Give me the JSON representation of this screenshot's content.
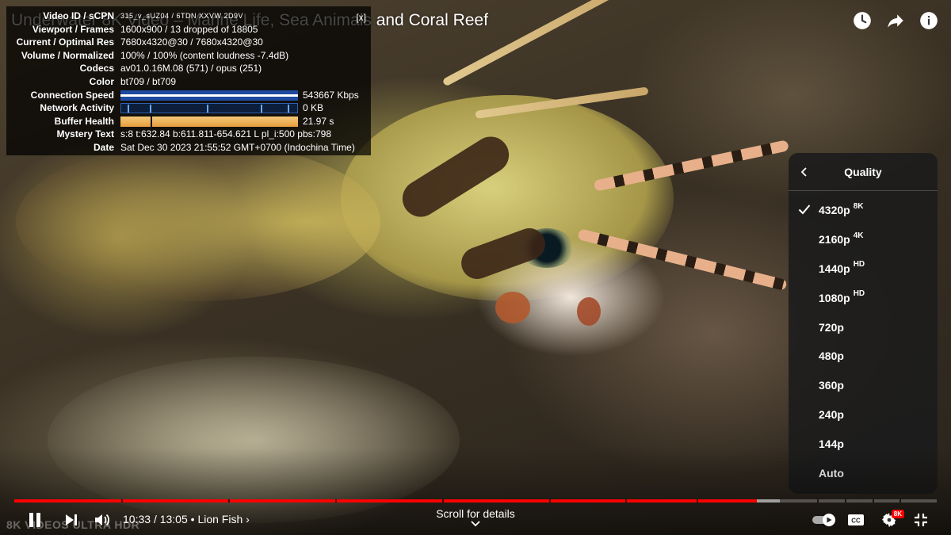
{
  "video": {
    "title": "Underwater 8K Video – Marine Life, Sea Animals and Coral Reef",
    "watermark": "8K VIDEOS ULTRA HDR"
  },
  "stats": {
    "close_label": "[x]",
    "video_id": {
      "label": "Video ID / sCPN",
      "value": "315_v_sUZ04 / 6TDN XXVW 2D9V"
    },
    "viewport": {
      "label": "Viewport / Frames",
      "value": "1600x900 / 13 dropped of 18805"
    },
    "resolution": {
      "label": "Current / Optimal Res",
      "value": "7680x4320@30 / 7680x4320@30"
    },
    "volume": {
      "label": "Volume / Normalized",
      "value": "100% / 100% (content loudness -7.4dB)"
    },
    "codecs": {
      "label": "Codecs",
      "value": "av01.0.16M.08 (571) / opus (251)"
    },
    "color": {
      "label": "Color",
      "value": "bt709 / bt709"
    },
    "connection": {
      "label": "Connection Speed",
      "value": "543667 Kbps"
    },
    "network": {
      "label": "Network Activity",
      "value": "0 KB"
    },
    "buffer": {
      "label": "Buffer Health",
      "value": "21.97 s"
    },
    "mystery": {
      "label": "Mystery Text",
      "value": "s:8 t:632.84 b:611.811-654.621 L pl_i:500 pbs:798"
    },
    "date": {
      "label": "Date",
      "value": "Sat Dec 30 2023 21:55:52 GMT+0700 (Indochina Time)"
    }
  },
  "quality_menu": {
    "title": "Quality",
    "selected": "4320p",
    "options": [
      {
        "label": "4320p",
        "badge": "8K"
      },
      {
        "label": "2160p",
        "badge": "4K"
      },
      {
        "label": "1440p",
        "badge": "HD"
      },
      {
        "label": "1080p",
        "badge": "HD"
      },
      {
        "label": "720p",
        "badge": ""
      },
      {
        "label": "480p",
        "badge": ""
      },
      {
        "label": "360p",
        "badge": ""
      },
      {
        "label": "240p",
        "badge": ""
      },
      {
        "label": "144p",
        "badge": ""
      },
      {
        "label": "Auto",
        "badge": ""
      }
    ]
  },
  "controls": {
    "current_time": "10:33",
    "duration": "13:05",
    "chapter": "• Lion Fish",
    "scroll_hint": "Scroll for details",
    "settings_badge": "8K",
    "progress_played": 0.805,
    "progress_loaded": 0.83
  },
  "icons": {
    "top": [
      "clock-icon",
      "share-icon",
      "info-icon"
    ],
    "bottom": [
      "pause-icon",
      "next-icon",
      "volume-icon",
      "autoplay-toggle-icon",
      "captions-icon",
      "settings-icon",
      "exit-fullscreen-icon"
    ]
  },
  "colors": {
    "accent": "#ff0000",
    "menu_bg": "#1c1c1c"
  }
}
